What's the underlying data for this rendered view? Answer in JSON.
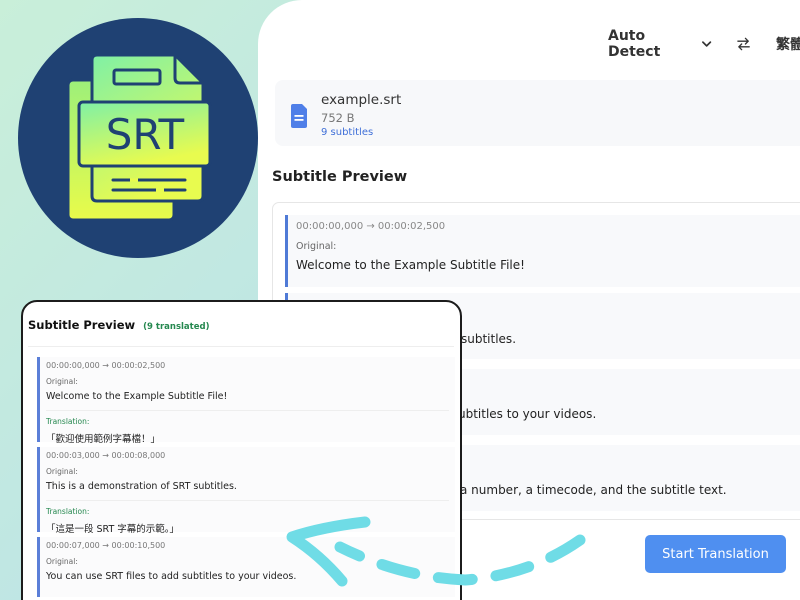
{
  "language_bar": {
    "source": "Auto Detect",
    "target": "繁體中"
  },
  "file": {
    "name": "example.srt",
    "size": "752 B",
    "count": "9 subtitles"
  },
  "preview": {
    "heading": "Subtitle Preview",
    "entries": [
      {
        "time": "00:00:00,000 → 00:00:02,500",
        "original_label": "Original:",
        "original_text": "Welcome to the Example Subtitle File!"
      }
    ],
    "partial_lines": [
      "subtitles.",
      "ubtitles to your videos.",
      "a number, a timecode, and the subtitle text."
    ],
    "start_button": "Start Translation"
  },
  "logo": {
    "text": "SRT",
    "icon": "srt-file-icon"
  },
  "front": {
    "title": "Subtitle Preview",
    "count": "(9 translated)",
    "entries": [
      {
        "time": "00:00:00,000 → 00:00:02,500",
        "original_label": "Original:",
        "original_text": "Welcome to the Example Subtitle File!",
        "translation_label": "Translation:",
        "translation_text": "「歡迎使用範例字幕檔！」"
      },
      {
        "time": "00:00:03,000 → 00:00:08,000",
        "original_label": "Original:",
        "original_text": "This is a demonstration of SRT subtitles.",
        "translation_label": "Translation:",
        "translation_text": "「這是一段 SRT 字幕的示範。」"
      },
      {
        "time": "00:00:07,000 → 00:00:10,500",
        "original_label": "Original:",
        "original_text": "You can use SRT files to add subtitles to your videos."
      }
    ]
  },
  "colors": {
    "accent": "#4f8ff0",
    "entry_border": "#5b7fd8",
    "translation": "#25884f",
    "logo_bg": "#1f4173",
    "arrow": "#6fdce6"
  }
}
